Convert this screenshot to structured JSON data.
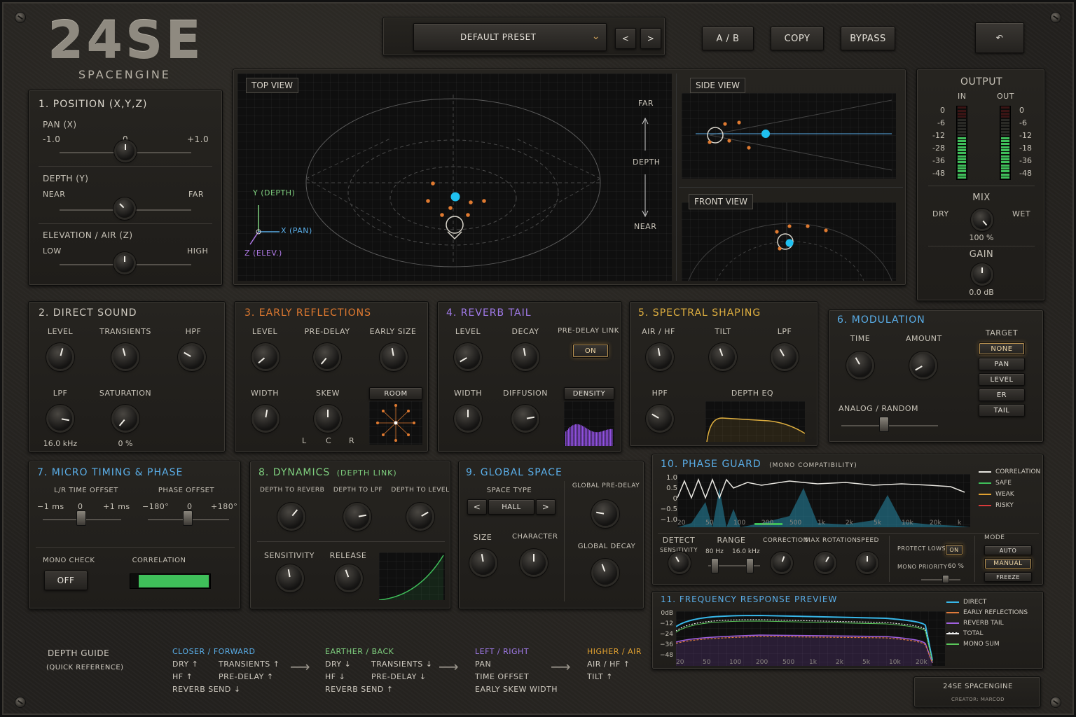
{
  "brand": {
    "logo": "24SE",
    "subtitle": "SPACENGINE"
  },
  "header": {
    "preset": "DEFAULT PRESET",
    "prev": "<",
    "next": ">",
    "ab": "A / B",
    "copy": "COPY",
    "bypass": "BYPASS",
    "undo": "↶"
  },
  "position": {
    "title": "1.  POSITION (X,Y,Z)",
    "pan_label": "PAN (X)",
    "pan_min": "-1.0",
    "pan_mid": "0",
    "pan_max": "+1.0",
    "depth_label": "DEPTH (Y)",
    "depth_min": "NEAR",
    "depth_max": "FAR",
    "elev_label": "ELEVATION / AIR (Z)",
    "elev_min": "LOW",
    "elev_max": "HIGH"
  },
  "views": {
    "top": "TOP VIEW",
    "side": "SIDE VIEW",
    "front": "FRONT VIEW",
    "far": "FAR",
    "depth": "DEPTH",
    "near": "NEAR",
    "axis_y": "Y (DEPTH)",
    "axis_x": "X (PAN)",
    "axis_z": "Z (ELEV.)"
  },
  "output": {
    "title": "OUTPUT",
    "in": "IN",
    "out": "OUT",
    "scale": [
      "0",
      "-6",
      "-12",
      "-28",
      "-36",
      "-48"
    ],
    "scale_out": [
      "0",
      "-6",
      "-12",
      "-18",
      "-36",
      "-48"
    ],
    "in_level": 0.62,
    "out_level": 0.6,
    "mix": "MIX",
    "dry": "DRY",
    "wet": "WET",
    "mix_value": "100 %",
    "gain": "GAIN",
    "gain_value": "0.0 dB"
  },
  "direct": {
    "title": "2.  DIRECT SOUND",
    "level": "LEVEL",
    "transients": "TRANSIENTS",
    "hpf": "HPF",
    "lpf": "LPF",
    "saturation": "SATURATION",
    "lpf_value": "16.0 kHz",
    "sat_value": "0 %"
  },
  "early": {
    "title": "3.  EARLY REFLECTIONS",
    "level": "LEVEL",
    "predelay": "PRE-DELAY",
    "size": "EARLY SIZE",
    "width": "WIDTH",
    "skew": "SKEW",
    "room": "ROOM",
    "l": "L",
    "c": "C",
    "r": "R"
  },
  "reverb": {
    "title": "4.  REVERB TAIL",
    "level": "LEVEL",
    "decay": "DECAY",
    "link": "PRE-DELAY LINK",
    "link_state": "ON",
    "width": "WIDTH",
    "diffusion": "DIFFUSION",
    "density": "DENSITY"
  },
  "spectral": {
    "title": "5.  SPECTRAL SHAPING",
    "air": "AIR / HF",
    "tilt": "TILT",
    "lpf": "LPF",
    "hpf": "HPF",
    "deq": "DEPTH EQ"
  },
  "modulation": {
    "title": "6.  MODULATION",
    "time": "TIME",
    "amount": "AMOUNT",
    "target": "TARGET",
    "targets": [
      "NONE",
      "PAN",
      "LEVEL",
      "ER",
      "TAIL"
    ],
    "analog": "ANALOG / RANDOM"
  },
  "micro": {
    "title": "7.  MICRO TIMING & PHASE",
    "lr": "L/R TIME OFFSET",
    "phase": "PHASE OFFSET",
    "lr_min": "−1 ms",
    "lr_mid": "0",
    "lr_max": "+1 ms",
    "ph_min": "−180°",
    "ph_mid": "0",
    "ph_max": "+180°",
    "mono": "MONO CHECK",
    "mono_state": "OFF",
    "corr": "CORRELATION"
  },
  "dynamics": {
    "title": "8.  DYNAMICS",
    "sub": "(DEPTH LINK)",
    "d2r": "DEPTH TO REVERB",
    "d2l": "DEPTH TO LPF",
    "d2lv": "DEPTH TO LEVEL",
    "sens": "SENSITIVITY",
    "rel": "RELEASE"
  },
  "global": {
    "title": "9.  GLOBAL SPACE",
    "type": "SPACE TYPE",
    "type_value": "HALL",
    "prev": "<",
    "next": ">",
    "size": "SIZE",
    "character": "CHARACTER",
    "gpd": "GLOBAL PRE-DELAY",
    "gdecay": "GLOBAL DECAY"
  },
  "phase": {
    "title": "10.  PHASE GUARD",
    "sub": "(MONO COMPATIBILITY)",
    "yticks": [
      "1.0",
      "0.5",
      "0",
      "−0.5",
      "−1.0"
    ],
    "xticks": [
      "20",
      "50",
      "100",
      "200",
      "500",
      "1k",
      "2k",
      "5k",
      "10k",
      "20k",
      "k"
    ],
    "legend": [
      "CORRELATION",
      "SAFE",
      "WEAK",
      "RISKY"
    ],
    "legend_colors": [
      "#e8e6e0",
      "#3fbf5a",
      "#e0a030",
      "#d83a3a"
    ],
    "detect": "DETECT",
    "sensitivity": "SENSITIVITY",
    "range": "RANGE",
    "r_lo": "80 Hz",
    "r_hi": "16.0 kHz",
    "correction": "CORRECTION",
    "maxrot": "MAX ROTATION",
    "speed": "SPEED",
    "protect": "PROTECT LOWS",
    "protect_state": "ON",
    "monoprio": "MONO PRIORITY",
    "monoprio_val": "60 %",
    "mode": "MODE",
    "modes": [
      "AUTO",
      "MANUAL",
      "FREEZE"
    ]
  },
  "freq": {
    "title": "11.  FREQUENCY RESPONSE PREVIEW",
    "yticks": [
      "0dB",
      "−12",
      "−24",
      "−36",
      "−48"
    ],
    "xticks": [
      "20",
      "50",
      "100",
      "200",
      "500",
      "1k",
      "2k",
      "5k",
      "10k",
      "20k"
    ],
    "legend": [
      "DIRECT",
      "EARLY REFLECTIONS",
      "REVERB TAIL",
      "TOTAL",
      "MONO SUM"
    ],
    "legend_colors": [
      "#37b6e8",
      "#e07a3a",
      "#a060e0",
      "#f0f0f0",
      "#5ac85a"
    ]
  },
  "guide": {
    "title": "DEPTH GUIDE",
    "sub": "(QUICK REFERENCE)",
    "closer": "CLOSER / FORWARD",
    "c1": "DRY ↑",
    "c2": "TRANSIENTS ↑",
    "c3": "HF ↑",
    "c4": "PRE-DELAY ↑",
    "c5": "REVERB SEND ↓",
    "earther": "EARTHER / BACK",
    "e1": "DRY ↓",
    "e2": "TRANSIENTS ↓",
    "e3": "HF ↓",
    "e4": "PRE-DELAY ↓",
    "e5": "REVERB SEND ↑",
    "lr": "LEFT / RIGHT",
    "l1": "PAN",
    "l2": "TIME OFFSET",
    "l3": "EARLY SKEW",
    "l4": "WIDTH",
    "hi": "HIGHER / AIR",
    "h1": "AIR / HF ↑",
    "h2": "TILT ↑"
  },
  "footer": {
    "name": "24SE SPACENGINE",
    "creator": "CREATOR: MARCOD"
  },
  "colors": {
    "orange": "#e07a30",
    "purple": "#a07ae8",
    "blue": "#5aaee8",
    "cyan": "#1fc0f0",
    "green": "#3fbf5a",
    "yellow": "#e0b040"
  }
}
